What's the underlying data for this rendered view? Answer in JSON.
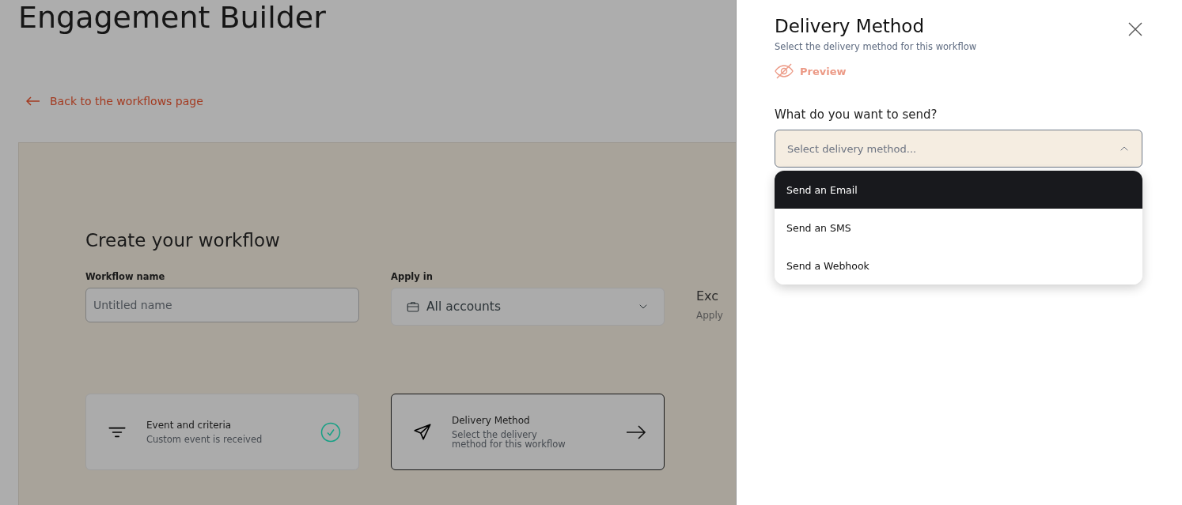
{
  "page": {
    "title": "Engagement Builder",
    "back_link": "Back to the workflows page"
  },
  "form": {
    "heading": "Create your workflow",
    "fields": [
      {
        "kind": "text",
        "label": "Workflow name",
        "placeholder": "Untitled name"
      },
      {
        "kind": "select",
        "label": "Apply in",
        "value": "All accounts"
      }
    ],
    "cut_column": {
      "title": "Exc",
      "subtitle": "Apply"
    },
    "steps": [
      {
        "title": "Event and criteria",
        "subtitle": "Custom event is received",
        "completed": true
      },
      {
        "title": "Delivery Method",
        "subtitle": "Select the delivery method for this workflow",
        "completed": false
      }
    ]
  },
  "panel": {
    "title": "Delivery Method",
    "subtitle": "Select the delivery method for this workflow",
    "preview": "Preview",
    "question": "What do you want to send?",
    "select": {
      "placeholder": "Select delivery method...",
      "expanded": true,
      "options": [
        {
          "label": "Send an Email",
          "selected": true
        },
        {
          "label": "Send an SMS",
          "selected": false
        },
        {
          "label": "Send a Webhook",
          "selected": false
        }
      ]
    }
  }
}
